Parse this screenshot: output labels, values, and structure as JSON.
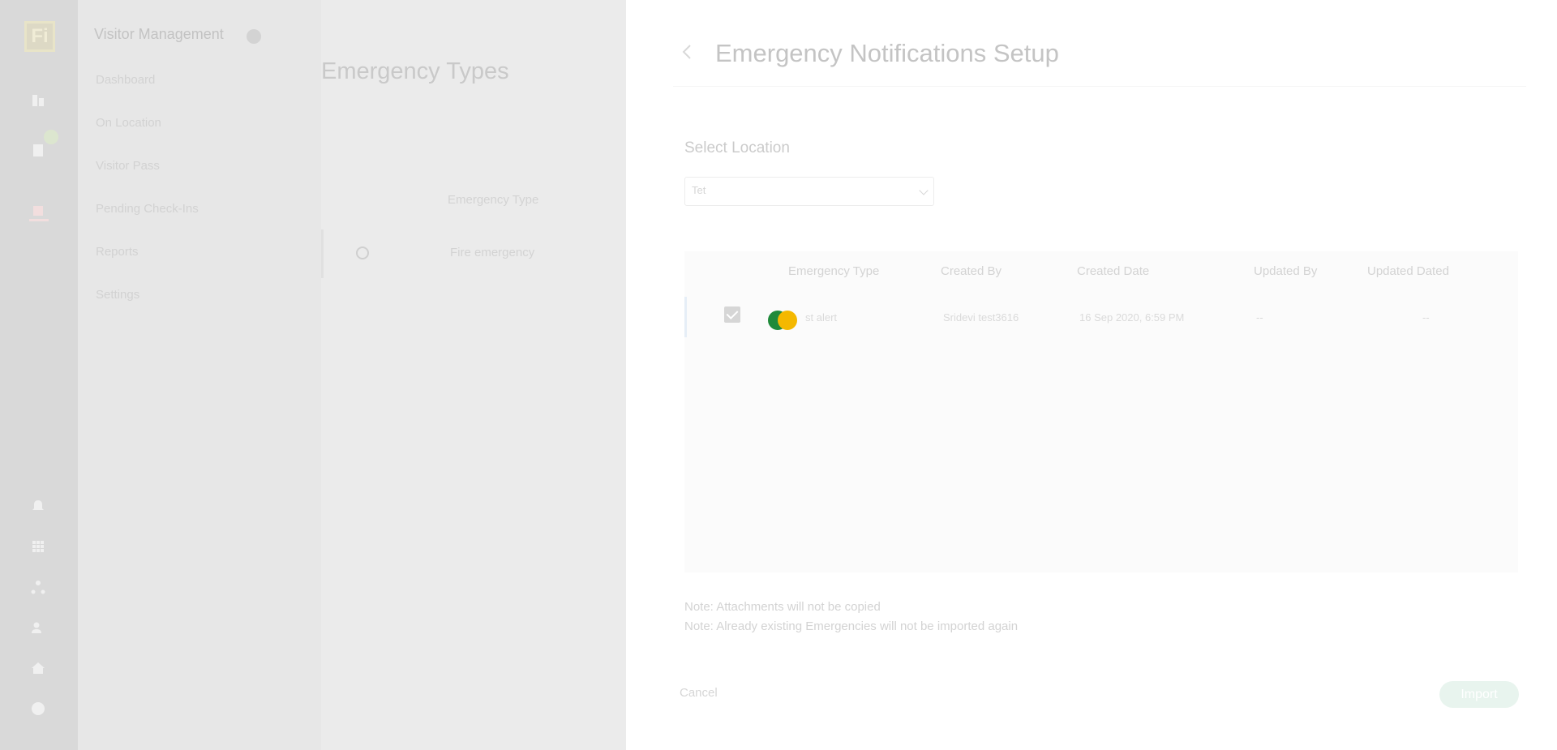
{
  "rail": {
    "logo_text": "Fi",
    "icons": [
      "building-icon",
      "office-icon",
      "emergency-icon",
      "bell-icon",
      "grid-icon",
      "network-icon",
      "user-add-icon",
      "home-icon",
      "account-icon"
    ]
  },
  "sidebar": {
    "title": "Visitor Management",
    "items": [
      {
        "label": "Dashboard"
      },
      {
        "label": "On Location"
      },
      {
        "label": "Visitor Pass"
      },
      {
        "label": "Pending Check-Ins"
      },
      {
        "label": "Reports"
      },
      {
        "label": "Settings"
      }
    ]
  },
  "main": {
    "title": "Emergency Types",
    "column_header": "Emergency Type",
    "row_text": "Fire emergency"
  },
  "panel": {
    "title": "Emergency Notifications Setup",
    "select_label": "Select Location",
    "select_value": "Tet",
    "table": {
      "headers": [
        "Emergency Type",
        "Created By",
        "Created Date",
        "Updated By",
        "Updated Dated"
      ],
      "rows": [
        {
          "type": "st alert",
          "created_by": "Sridevi test3616",
          "created_date": "16 Sep 2020, 6:59 PM",
          "updated_by": "--",
          "updated_dated": "--"
        }
      ]
    },
    "notes": [
      "Note: Attachments will not be copied",
      "Note: Already existing Emergencies will not be imported again"
    ],
    "cancel_label": "Cancel",
    "import_label": "Import"
  },
  "colors": {
    "loader_green": "#1f8a3a",
    "loader_yellow": "#f4b800",
    "import_button": "#e8f4ee"
  }
}
